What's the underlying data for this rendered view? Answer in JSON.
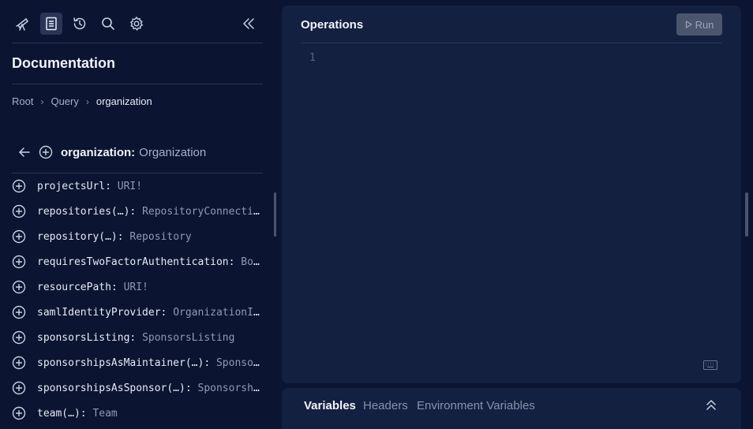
{
  "sidebar": {
    "tools": [
      {
        "name": "explorer-icon"
      },
      {
        "name": "docs-icon",
        "active": true
      },
      {
        "name": "history-icon"
      },
      {
        "name": "search-icon"
      },
      {
        "name": "gear-icon"
      }
    ],
    "collapse_icon": "double-chevron-left-icon"
  },
  "docs": {
    "title": "Documentation",
    "breadcrumb": [
      "Root",
      "Query",
      "organization"
    ],
    "field": {
      "name": "organization:",
      "type": "Organization"
    },
    "fields": [
      {
        "name": "projectsUrl:",
        "type": "URI!"
      },
      {
        "name": "repositories(…):",
        "type": "RepositoryConnection!"
      },
      {
        "name": "repository(…):",
        "type": "Repository"
      },
      {
        "name": "requiresTwoFactorAuthentication:",
        "type": "Boolean"
      },
      {
        "name": "resourcePath:",
        "type": "URI!"
      },
      {
        "name": "samlIdentityProvider:",
        "type": "OrganizationIdentityProvider"
      },
      {
        "name": "sponsorsListing:",
        "type": "SponsorsListing"
      },
      {
        "name": "sponsorshipsAsMaintainer(…):",
        "type": "SponsorshipConnection!"
      },
      {
        "name": "sponsorshipsAsSponsor(…):",
        "type": "SponsorshipConnection!"
      },
      {
        "name": "team(…):",
        "type": "Team"
      }
    ]
  },
  "editor": {
    "title": "Operations",
    "run_label": "Run",
    "line_number": "1"
  },
  "bottom": {
    "tabs": [
      "Variables",
      "Headers",
      "Environment Variables"
    ]
  },
  "colors": {
    "background": "#0b1431",
    "panel": "#14203f",
    "run_button": "#4b556e"
  }
}
